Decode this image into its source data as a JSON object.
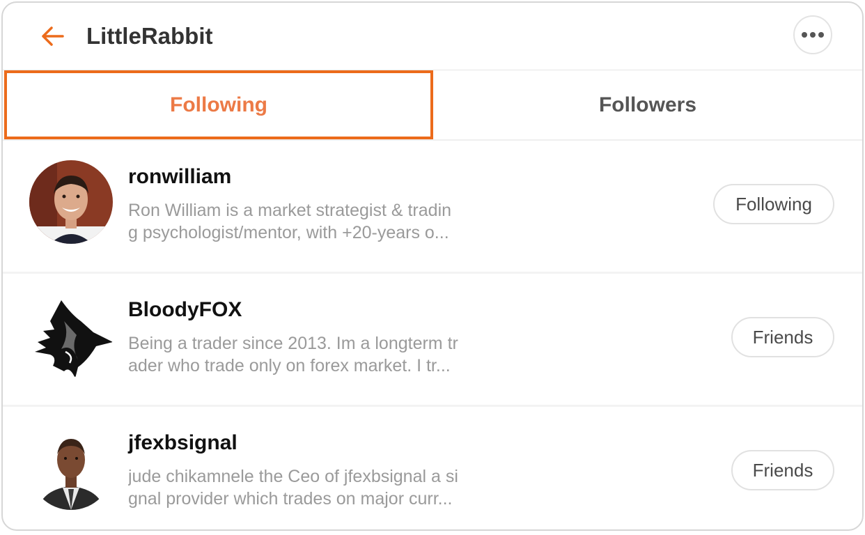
{
  "header": {
    "title": "LittleRabbit",
    "back_icon": "arrow-left-icon",
    "more_icon": "more-horizontal-icon",
    "accent_color": "#ec6b1b"
  },
  "tabs": [
    {
      "label": "Following",
      "active": true,
      "color": "#ec7a46"
    },
    {
      "label": "Followers",
      "active": false,
      "color": "#555555"
    }
  ],
  "users": [
    {
      "username": "ronwilliam",
      "bio_line1": "Ron William is a market strategist & tradin",
      "bio_line2": "g psychologist/mentor, with +20-years o...",
      "button": "Following",
      "avatar": "person-photo-avatar"
    },
    {
      "username": "BloodyFOX",
      "bio_line1": "Being a trader since 2013. Im a longterm tr",
      "bio_line2": "ader who trade only on forex market. I tr...",
      "button": "Friends",
      "avatar": "fox-logo-avatar"
    },
    {
      "username": "jfexbsignal",
      "bio_line1": "jude chikamnele the Ceo of jfexbsignal a si",
      "bio_line2": "gnal provider which trades on major curr...",
      "button": "Friends",
      "avatar": "person-photo-avatar"
    }
  ]
}
